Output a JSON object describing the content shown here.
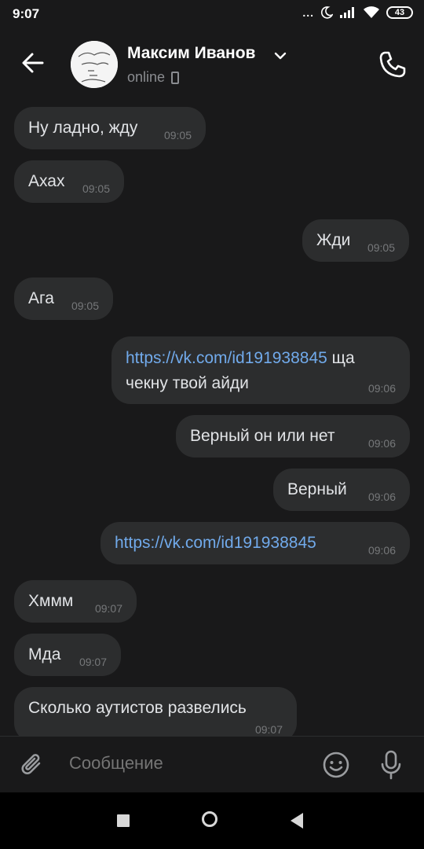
{
  "status_bar": {
    "time": "9:07",
    "dots": "...",
    "battery": "43"
  },
  "header": {
    "name": "Максим Иванов",
    "status": "online"
  },
  "messages": [
    {
      "side": "in",
      "text": "Ну ладно, жду",
      "time": "09:05"
    },
    {
      "side": "in",
      "text": "Ахах",
      "time": "09:05"
    },
    {
      "side": "out",
      "text": "Жди",
      "time": "09:05"
    },
    {
      "side": "in",
      "text": "Ага",
      "time": "09:05"
    },
    {
      "side": "out",
      "link": "https://vk.com/id191938845",
      "text": " ща чекну твой айди",
      "time": "09:06"
    },
    {
      "side": "out",
      "text": "Верный он или нет",
      "time": "09:06"
    },
    {
      "side": "out",
      "text": "Верный",
      "time": "09:06"
    },
    {
      "side": "out",
      "link": "https://vk.com/id191938845",
      "text": "",
      "time": "09:06"
    },
    {
      "side": "in",
      "text": "Хммм",
      "time": "09:07"
    },
    {
      "side": "in",
      "text": "Мда",
      "time": "09:07"
    },
    {
      "side": "in",
      "text": "Сколько аутистов развелись",
      "time": "09:07"
    }
  ],
  "composer": {
    "placeholder": "Сообщение"
  },
  "colors": {
    "bubble": "#2c2d2e",
    "background": "#19191a",
    "link": "#71aaeb",
    "time": "#76787a"
  }
}
